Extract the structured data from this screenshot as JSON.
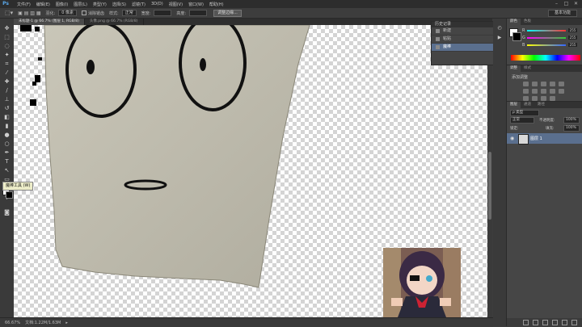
{
  "app": {
    "logo": "Ps"
  },
  "menu": [
    "文件(F)",
    "编辑(E)",
    "图像(I)",
    "图层(L)",
    "类型(Y)",
    "选择(S)",
    "滤镜(T)",
    "3D(D)",
    "视图(V)",
    "窗口(W)",
    "帮助(H)"
  ],
  "window_controls": [
    "–",
    "□",
    "✕"
  ],
  "options": {
    "feather_label": "羽化:",
    "feather_value": "0 像素",
    "antialias_label": "消除锯齿",
    "style_label": "样式:",
    "style_value": "正常",
    "width_label": "宽度:",
    "height_label": "高度:",
    "refine_button": "调整边缘...",
    "workspace": "基本功能"
  },
  "doc_tabs": [
    "未标题-1 @ 66.7% (图层 1, RGB/8)",
    "头像.png @ 66.7% (RGB/8)"
  ],
  "tooltip": "魔棒工具 (W)",
  "status": {
    "zoom": "66.67%",
    "doc": "文档:1.22M/1.63M"
  },
  "history": {
    "title": "历史记录",
    "rows": [
      "新建",
      "粘贴",
      "魔棒"
    ]
  },
  "color_panel": {
    "tabs": [
      "颜色",
      "色板"
    ],
    "sliders": [
      {
        "label": "R",
        "value": "255",
        "color": "#ff3333"
      },
      {
        "label": "G",
        "value": "255",
        "color": "#33cc33"
      },
      {
        "label": "B",
        "value": "255",
        "color": "#3366ff"
      }
    ]
  },
  "adjust_panel": {
    "tabs": [
      "调整",
      "样式"
    ],
    "title": "添加调整"
  },
  "layers_panel": {
    "tabs": [
      "图层",
      "通道",
      "路径"
    ],
    "kind_label": "ρ 类型",
    "blend": "正常",
    "opacity_label": "不透明度:",
    "opacity_value": "100%",
    "lock_label": "锁定:",
    "fill_label": "填充:",
    "fill_value": "100%",
    "layer_name": "图层 1"
  }
}
